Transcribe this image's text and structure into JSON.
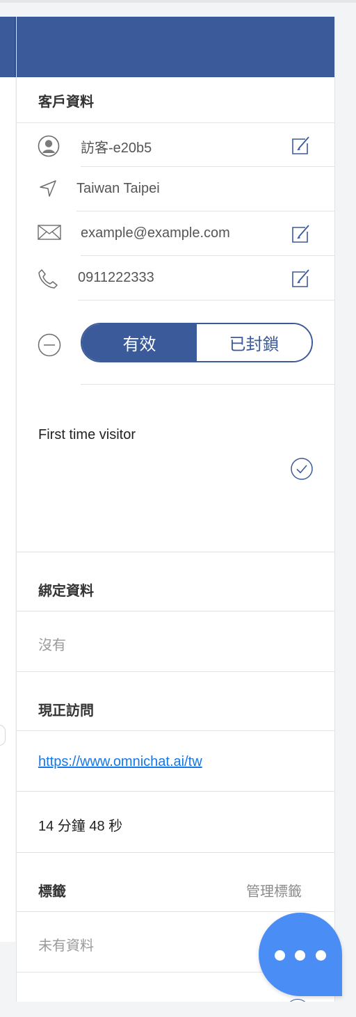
{
  "customer_info": {
    "title": "客戶資料",
    "visitor_name": "訪客-e20b5",
    "location": "Taiwan Taipei",
    "email": "example@example.com",
    "phone": "0911222333",
    "status": {
      "active_label": "有效",
      "blocked_label": "已封鎖",
      "selected": "有效"
    },
    "note": "First time visitor"
  },
  "bound_data": {
    "title": "綁定資料",
    "value": "沒有"
  },
  "current_visit": {
    "title": "現正訪問",
    "url": "https://www.omnichat.ai/tw",
    "duration": "14 分鐘 48 秒"
  },
  "tags": {
    "title": "標籤",
    "manage_label": "管理標籤",
    "empty_text": "未有資料"
  },
  "colors": {
    "header": "#3a5a99",
    "accent": "#3a5a99",
    "link": "#1677e8",
    "chat_bubble": "#4a8ef5"
  },
  "icons": [
    "user-icon",
    "location-arrow-icon",
    "mail-icon",
    "phone-icon",
    "edit-icon",
    "minus-circle-icon",
    "check-circle-icon",
    "chat-more-icon"
  ]
}
